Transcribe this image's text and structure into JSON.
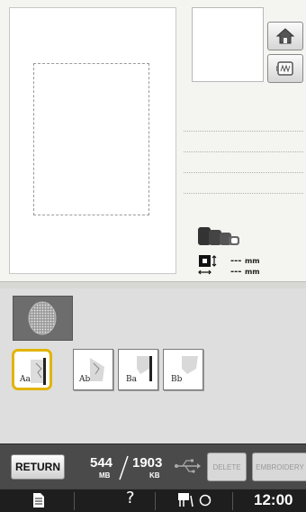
{
  "preview": {
    "size_unit_w": "mm",
    "size_unit_h": "mm",
    "size_value_w": "---",
    "size_value_h": "---"
  },
  "side_buttons": {
    "home_icon": "home-icon",
    "frame_icon": "embroidery-frame-icon"
  },
  "pattern_types": [
    {
      "label": "Aa",
      "selected": true
    },
    {
      "label": "Ab",
      "selected": false
    },
    {
      "label": "Ba",
      "selected": false
    },
    {
      "label": "Bb",
      "selected": false
    }
  ],
  "status_bar": {
    "return_label": "RETURN",
    "memory_used": "544",
    "memory_used_unit": "MB",
    "memory_free": "1903",
    "memory_free_unit": "KB",
    "delete_label": "DELETE",
    "embroidery_label": "EMBROIDERY"
  },
  "bottom_bar": {
    "help_label": "?",
    "time": "12:00"
  },
  "colors": {
    "selection_accent": "#e2b400",
    "status_bar_bg": "#4a4a4a",
    "bottom_bar_bg": "#1e1e1e"
  }
}
